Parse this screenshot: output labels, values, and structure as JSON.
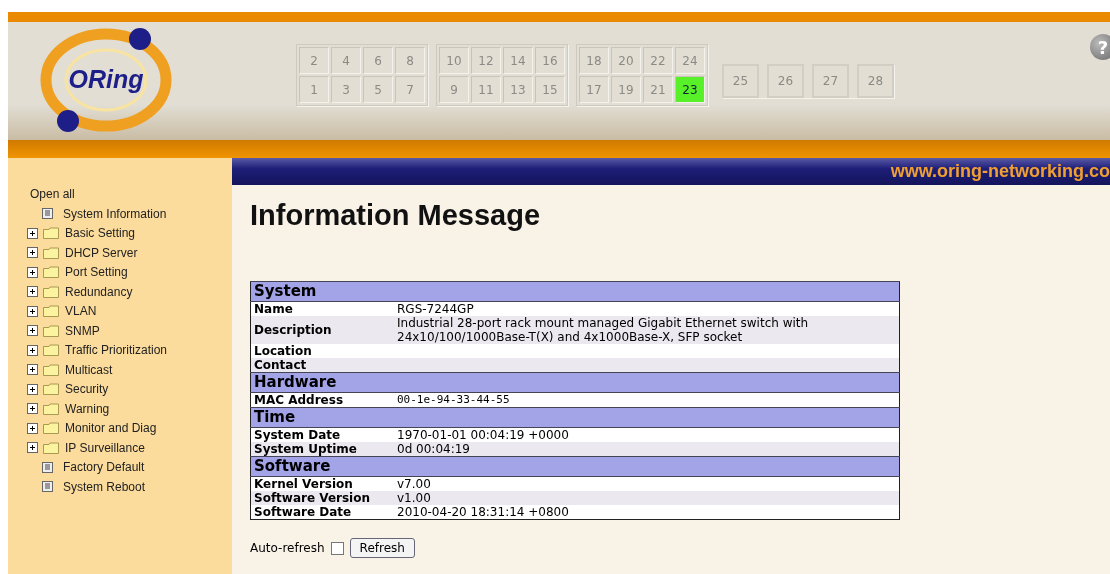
{
  "logo": {
    "text": "ORing"
  },
  "port_groups": [
    {
      "kind": "block",
      "ports": [
        {
          "label": "2",
          "active": false
        },
        {
          "label": "4",
          "active": false
        },
        {
          "label": "6",
          "active": false
        },
        {
          "label": "8",
          "active": false
        },
        {
          "label": "1",
          "active": false
        },
        {
          "label": "3",
          "active": false
        },
        {
          "label": "5",
          "active": false
        },
        {
          "label": "7",
          "active": false
        }
      ]
    },
    {
      "kind": "block",
      "ports": [
        {
          "label": "10",
          "active": false
        },
        {
          "label": "12",
          "active": false
        },
        {
          "label": "14",
          "active": false
        },
        {
          "label": "16",
          "active": false
        },
        {
          "label": "9",
          "active": false
        },
        {
          "label": "11",
          "active": false
        },
        {
          "label": "13",
          "active": false
        },
        {
          "label": "15",
          "active": false
        }
      ]
    },
    {
      "kind": "block",
      "ports": [
        {
          "label": "18",
          "active": false
        },
        {
          "label": "20",
          "active": false
        },
        {
          "label": "22",
          "active": false
        },
        {
          "label": "24",
          "active": false
        },
        {
          "label": "17",
          "active": false
        },
        {
          "label": "19",
          "active": false
        },
        {
          "label": "21",
          "active": false
        },
        {
          "label": "23",
          "active": true
        }
      ]
    },
    {
      "kind": "single",
      "ports": [
        {
          "label": "25",
          "active": false
        },
        {
          "label": "26",
          "active": false
        },
        {
          "label": "27",
          "active": false
        },
        {
          "label": "28",
          "active": false
        }
      ]
    }
  ],
  "help": {
    "text": "?"
  },
  "banner": {
    "url": "www.oring-networking.co"
  },
  "sidebar": {
    "open_all": "Open all",
    "items": [
      {
        "kind": "page",
        "label": "System Information"
      },
      {
        "kind": "folder",
        "label": "Basic Setting",
        "expanded": false
      },
      {
        "kind": "folder",
        "label": "DHCP Server",
        "expanded": false
      },
      {
        "kind": "folder",
        "label": "Port Setting",
        "expanded": false
      },
      {
        "kind": "folder",
        "label": "Redundancy",
        "expanded": false
      },
      {
        "kind": "folder",
        "label": "VLAN",
        "expanded": false
      },
      {
        "kind": "folder",
        "label": "SNMP",
        "expanded": false
      },
      {
        "kind": "folder",
        "label": "Traffic Prioritization",
        "expanded": false
      },
      {
        "kind": "folder",
        "label": "Multicast",
        "expanded": false
      },
      {
        "kind": "folder",
        "label": "Security",
        "expanded": false
      },
      {
        "kind": "folder",
        "label": "Warning",
        "expanded": false
      },
      {
        "kind": "folder",
        "label": "Monitor and Diag",
        "expanded": false
      },
      {
        "kind": "folder",
        "label": "IP Surveillance",
        "expanded": false
      },
      {
        "kind": "page",
        "label": "Factory Default"
      },
      {
        "kind": "page",
        "label": "System Reboot"
      }
    ]
  },
  "heading": "Information Message",
  "sections": [
    {
      "title": "System",
      "rows": [
        {
          "label": "Name",
          "value": "RGS-7244GP"
        },
        {
          "label": "Description",
          "value": "Industrial 28-port rack mount managed Gigabit Ethernet switch with 24x10/100/1000Base-T(X) and 4x1000Base-X, SFP socket"
        },
        {
          "label": "Location"
        },
        {
          "label": "Contact"
        }
      ]
    },
    {
      "title": "Hardware",
      "rows": [
        {
          "label": "MAC Address",
          "value": "00-1e-94-33-44-55",
          "kind": "mono"
        }
      ]
    },
    {
      "title": "Time",
      "rows": [
        {
          "label": "System Date",
          "value": "1970-01-01 00:04:19 +0000"
        },
        {
          "label": "System Uptime",
          "value": "0d 00:04:19"
        }
      ]
    },
    {
      "title": "Software",
      "rows": [
        {
          "label": "Kernel Version",
          "value": "v7.00"
        },
        {
          "label": "Software Version",
          "value": "v1.00"
        },
        {
          "label": "Software Date",
          "value": "2010-04-20 18:31:14 +0800"
        }
      ]
    }
  ],
  "auto_refresh": {
    "label": "Auto-refresh",
    "checked": false
  },
  "refresh_button": "Refresh"
}
